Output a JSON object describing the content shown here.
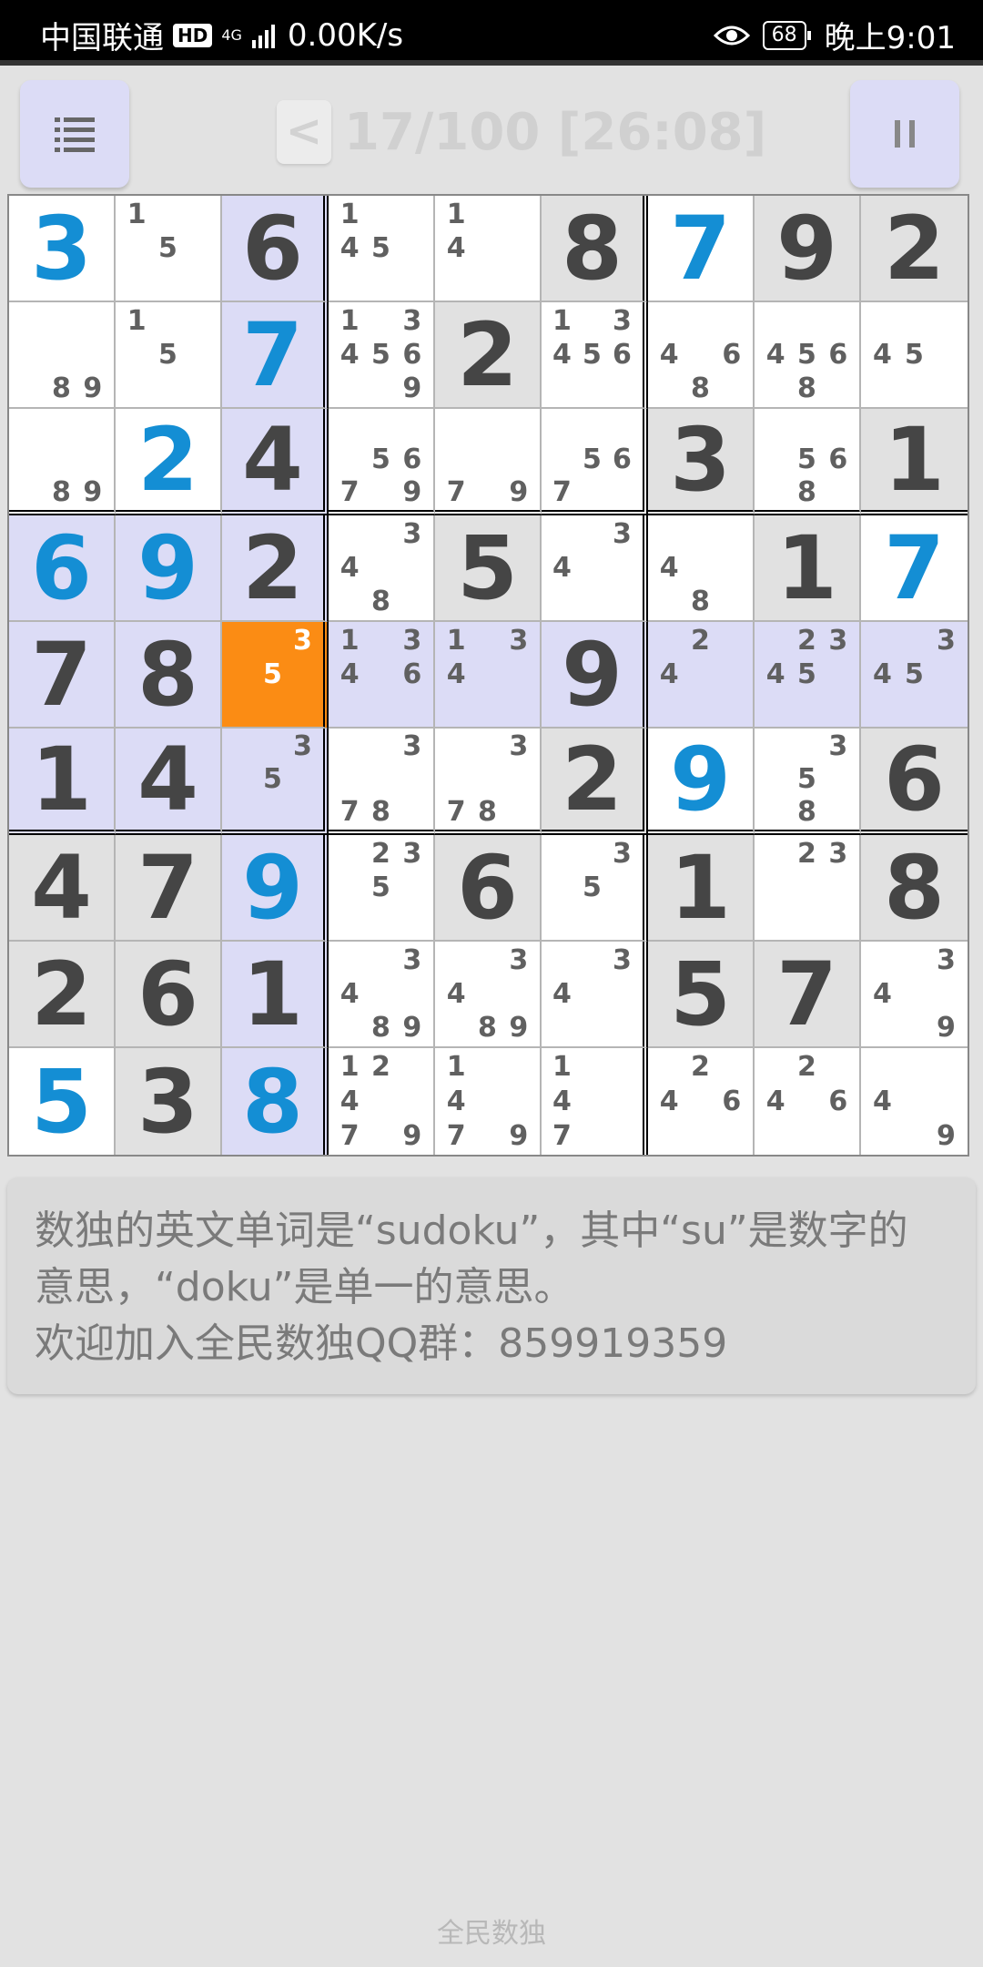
{
  "status_bar": {
    "carrier": "中国联通",
    "hd_badge": "HD",
    "network_type": "4G",
    "speed": "0.00K/s",
    "battery": "68",
    "time": "晚上9:01",
    "icons": [
      "hd-icon",
      "signal-icon",
      "eye-icon",
      "battery-icon"
    ]
  },
  "header": {
    "back_label": "<",
    "progress": "17/100 [26:08]",
    "menu_icon": "list-icon",
    "pause_icon": "pause-icon"
  },
  "colors": {
    "given_digit": "#454545",
    "user_digit": "#148ed4",
    "highlight": "#dcdcf6",
    "selected": "#fb8c14",
    "given_cell": "#e1e1e1"
  },
  "board": {
    "selected_cell": [
      4,
      2
    ],
    "highlighted_cells": [
      [
        0,
        2
      ],
      [
        1,
        2
      ],
      [
        2,
        2
      ],
      [
        3,
        0
      ],
      [
        3,
        1
      ],
      [
        3,
        2
      ],
      [
        4,
        0
      ],
      [
        4,
        1
      ],
      [
        4,
        3
      ],
      [
        4,
        4
      ],
      [
        4,
        5
      ],
      [
        4,
        6
      ],
      [
        4,
        7
      ],
      [
        4,
        8
      ],
      [
        5,
        0
      ],
      [
        5,
        1
      ],
      [
        5,
        2
      ],
      [
        6,
        2
      ],
      [
        7,
        2
      ],
      [
        8,
        2
      ]
    ],
    "rows": [
      [
        {
          "v": "3",
          "t": "user"
        },
        {
          "n": [
            1,
            5
          ]
        },
        {
          "v": "6",
          "t": "given"
        },
        {
          "n": [
            1,
            4,
            5
          ]
        },
        {
          "n": [
            1,
            4
          ]
        },
        {
          "v": "8",
          "t": "given"
        },
        {
          "v": "7",
          "t": "user"
        },
        {
          "v": "9",
          "t": "given"
        },
        {
          "v": "2",
          "t": "given"
        }
      ],
      [
        {
          "n": [
            8,
            9
          ]
        },
        {
          "n": [
            1,
            5
          ]
        },
        {
          "v": "7",
          "t": "user"
        },
        {
          "n": [
            1,
            3,
            4,
            5,
            6,
            9
          ]
        },
        {
          "v": "2",
          "t": "given"
        },
        {
          "n": [
            1,
            3,
            4,
            5,
            6
          ]
        },
        {
          "n": [
            4,
            6,
            8
          ]
        },
        {
          "n": [
            4,
            5,
            6,
            8
          ]
        },
        {
          "n": [
            4,
            5
          ]
        }
      ],
      [
        {
          "n": [
            8,
            9
          ]
        },
        {
          "v": "2",
          "t": "user"
        },
        {
          "v": "4",
          "t": "given"
        },
        {
          "n": [
            5,
            6,
            7,
            9
          ]
        },
        {
          "n": [
            7,
            9
          ]
        },
        {
          "n": [
            5,
            6,
            7
          ]
        },
        {
          "v": "3",
          "t": "given"
        },
        {
          "n": [
            5,
            6,
            8
          ]
        },
        {
          "v": "1",
          "t": "given"
        }
      ],
      [
        {
          "v": "6",
          "t": "user"
        },
        {
          "v": "9",
          "t": "user"
        },
        {
          "v": "2",
          "t": "given"
        },
        {
          "n": [
            3,
            4,
            8
          ]
        },
        {
          "v": "5",
          "t": "given"
        },
        {
          "n": [
            3,
            4
          ]
        },
        {
          "n": [
            4,
            8
          ]
        },
        {
          "v": "1",
          "t": "given"
        },
        {
          "v": "7",
          "t": "user"
        }
      ],
      [
        {
          "v": "7",
          "t": "given"
        },
        {
          "v": "8",
          "t": "given"
        },
        {
          "n": [
            3,
            5
          ]
        },
        {
          "n": [
            1,
            3,
            4,
            6
          ]
        },
        {
          "n": [
            1,
            3,
            4
          ]
        },
        {
          "v": "9",
          "t": "given"
        },
        {
          "n": [
            2,
            4
          ]
        },
        {
          "n": [
            2,
            3,
            4,
            5
          ]
        },
        {
          "n": [
            3,
            4,
            5
          ]
        }
      ],
      [
        {
          "v": "1",
          "t": "given"
        },
        {
          "v": "4",
          "t": "given"
        },
        {
          "n": [
            3,
            5
          ]
        },
        {
          "n": [
            3,
            7,
            8
          ]
        },
        {
          "n": [
            3,
            7,
            8
          ]
        },
        {
          "v": "2",
          "t": "given"
        },
        {
          "v": "9",
          "t": "user"
        },
        {
          "n": [
            3,
            5,
            8
          ]
        },
        {
          "v": "6",
          "t": "given"
        }
      ],
      [
        {
          "v": "4",
          "t": "given"
        },
        {
          "v": "7",
          "t": "given"
        },
        {
          "v": "9",
          "t": "user"
        },
        {
          "n": [
            2,
            3,
            5
          ]
        },
        {
          "v": "6",
          "t": "given"
        },
        {
          "n": [
            3,
            5
          ]
        },
        {
          "v": "1",
          "t": "given"
        },
        {
          "n": [
            2,
            3
          ]
        },
        {
          "v": "8",
          "t": "given"
        }
      ],
      [
        {
          "v": "2",
          "t": "given"
        },
        {
          "v": "6",
          "t": "given"
        },
        {
          "v": "1",
          "t": "given"
        },
        {
          "n": [
            3,
            4,
            8,
            9
          ]
        },
        {
          "n": [
            3,
            4,
            8,
            9
          ]
        },
        {
          "n": [
            3,
            4
          ]
        },
        {
          "v": "5",
          "t": "given"
        },
        {
          "v": "7",
          "t": "given"
        },
        {
          "n": [
            3,
            4,
            9
          ]
        }
      ],
      [
        {
          "v": "5",
          "t": "user"
        },
        {
          "v": "3",
          "t": "given"
        },
        {
          "v": "8",
          "t": "user"
        },
        {
          "n": [
            1,
            2,
            4,
            7,
            9
          ]
        },
        {
          "n": [
            1,
            4,
            7,
            9
          ]
        },
        {
          "n": [
            1,
            4,
            7
          ]
        },
        {
          "n": [
            2,
            4,
            6
          ]
        },
        {
          "n": [
            2,
            4,
            6
          ]
        },
        {
          "n": [
            4,
            9
          ]
        }
      ]
    ]
  },
  "tip": {
    "line1": "数独的英文单词是“sudoku”，其中“su”是数字的",
    "line2": "意思，“doku”是单一的意思。",
    "line3": "欢迎加入全民数独QQ群：859919359"
  },
  "footer": {
    "app_name": "全民数独"
  }
}
